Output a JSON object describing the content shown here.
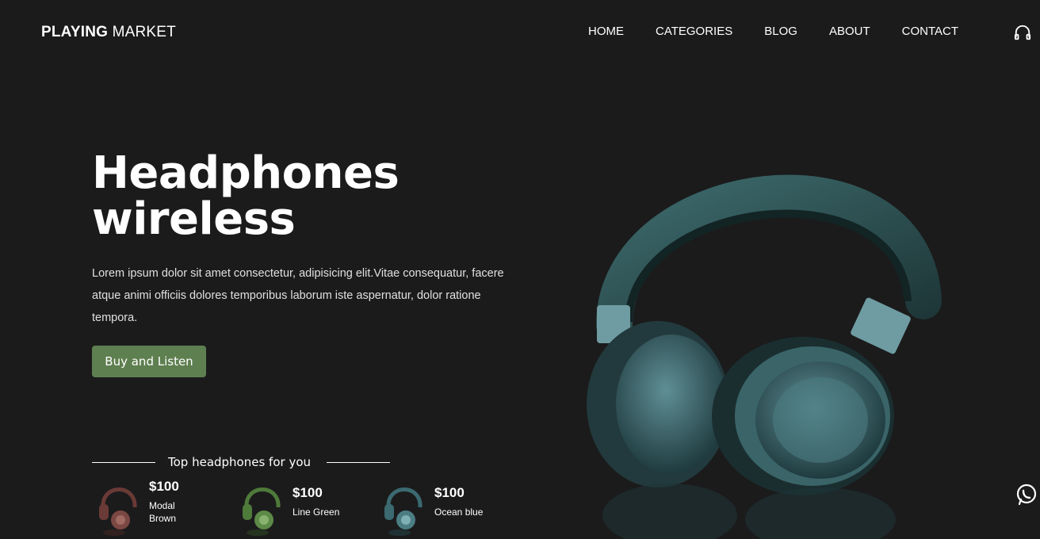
{
  "brand": {
    "bold": "PLAYING",
    "light": " MARKET"
  },
  "nav": [
    "HOME",
    "CATEGORIES",
    "BLOG",
    "ABOUT",
    "CONTACT"
  ],
  "hero": {
    "title_line1": "Headphones",
    "title_line2": "wireless",
    "description": "Lorem ipsum dolor sit amet consectetur, adipisicing elit.Vitae consequatur, facere atque animi officiis dolores temporibus laborum iste aspernatur, dolor ratione tempora.",
    "button": "Buy and Listen"
  },
  "top_section": {
    "label": "Top headphones for you",
    "products": [
      {
        "price": "$100",
        "name": "Modal Brown",
        "color": "#6a3a36"
      },
      {
        "price": "$100",
        "name": "Line Green",
        "color": "#4e7a3a"
      },
      {
        "price": "$100",
        "name": "Ocean blue",
        "color": "#3b6a70"
      }
    ]
  },
  "icons": {
    "header": "headphones-icon",
    "floating": "whatsapp-icon"
  },
  "colors": {
    "background": "#1b1b1c",
    "accent": "#5e7f50",
    "product_main": "#2f5c5c"
  }
}
